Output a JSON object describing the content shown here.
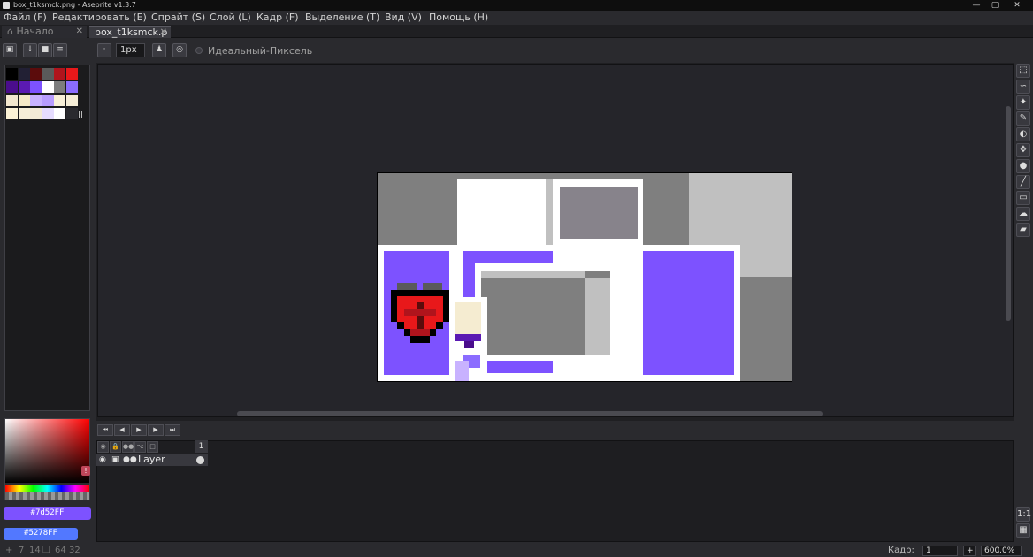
{
  "window": {
    "title": "box_t1ksmck.png - Aseprite v1.3.7",
    "buttons": [
      "—",
      "▢",
      "✕"
    ]
  },
  "menu": [
    "Файл (F)",
    "Редактировать (E)",
    "Спрайт (S)",
    "Слой (L)",
    "Кадр (F)",
    "Выделение (T)",
    "Вид (V)",
    "Помощь (H)"
  ],
  "tabs": {
    "home": "Начало",
    "active": "box_t1ksmck.p",
    "close": "✕"
  },
  "toolbar": {
    "brush_size": "1px",
    "pixel_perfect_label": "Идеальный-Пиксель"
  },
  "palette": {
    "colors": [
      "#000000",
      "#222034",
      "#5b0c0c",
      "#5a5a5a",
      "#b0141c",
      "#e8181a",
      "#4a0d8c",
      "#5b1ab3",
      "#7d52ff",
      "#ffffff",
      "#7d7d7d",
      "#8b6cff",
      "#f3e8cf",
      "#f6eac8",
      "#c8b2ff",
      "#b79cff",
      "#f8f0d8",
      "#f5edd6",
      "#fbf2d6",
      "#f6eed8",
      "#f3ead6",
      "#e6dcff",
      "#ffffff",
      "#2a2a2e"
    ]
  },
  "colors": {
    "foreground": "#7d52ff",
    "background": "#5278ff",
    "foreground_label": "#7d52FF",
    "background_label": "#5278FF"
  },
  "timeline": {
    "frame_number": "1",
    "layer_name": "Layer"
  },
  "status": {
    "cursor_x": "7",
    "cursor_y": "14",
    "sprite_w": "64",
    "sprite_h": "32",
    "frame_label": "Кадр:",
    "frame_value": "1",
    "add": "+",
    "zoom": "600.0%"
  }
}
